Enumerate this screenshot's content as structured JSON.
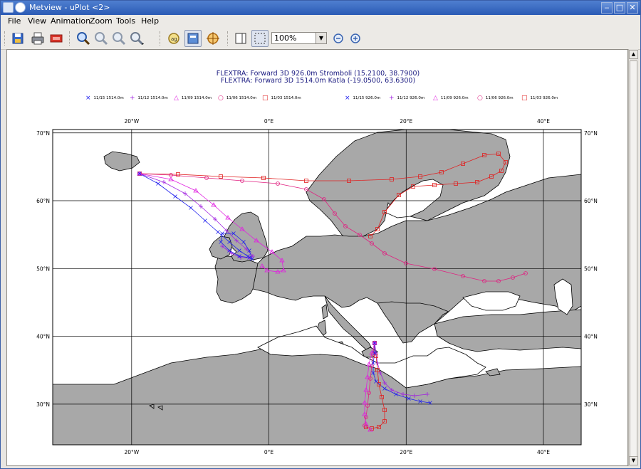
{
  "window": {
    "title": "Metview - uPlot <2>"
  },
  "menu": [
    "File",
    "View",
    "Animation",
    "Zoom",
    "Tools",
    "Help"
  ],
  "toolbar": {
    "zoom_level": "100%",
    "icons": [
      "save-icon",
      "print-icon",
      "export-icon",
      "zoom-icon",
      "zoom-in-icon",
      "zoom-out-icon",
      "zoom-area-icon",
      "magnify-icon",
      "layout-icon",
      "cursor-data-icon",
      "sidebar-icon",
      "frame-icon",
      "zoom-level-select",
      "zoom-out-icon",
      "zoom-in-icon"
    ]
  },
  "plot": {
    "title_lines": [
      "FLEXTRA: Forward 3D 926.0m Stromboli (15.2100, 38.7900)",
      "FLEXTRA: Forward 3D 1514.0m Katla (-19.0500, 63.6300)"
    ],
    "legend": [
      {
        "marker": "×",
        "label": "11/15 1514.0m",
        "color": "#2020ee"
      },
      {
        "marker": "+",
        "label": "11/12 1514.0m",
        "color": "#a020e0"
      },
      {
        "marker": "△",
        "label": "11/09 1514.0m",
        "color": "#e020e0"
      },
      {
        "marker": "○",
        "label": "11/06 1514.0m",
        "color": "#e02080"
      },
      {
        "marker": "□",
        "label": "11/03 1514.0m",
        "color": "#e02020"
      },
      {
        "marker": "×",
        "label": "11/15 926.0m",
        "color": "#2020ee"
      },
      {
        "marker": "+",
        "label": "11/12 926.0m",
        "color": "#a020e0"
      },
      {
        "marker": "△",
        "label": "11/09 926.0m",
        "color": "#e020e0"
      },
      {
        "marker": "○",
        "label": "11/06 926.0m",
        "color": "#e02080"
      },
      {
        "marker": "□",
        "label": "11/03 926.0m",
        "color": "#e02020"
      }
    ],
    "lon_labels": [
      "20°W",
      "0°E",
      "20°E",
      "40°E"
    ],
    "lat_labels": [
      "70°N",
      "60°N",
      "50°N",
      "40°N",
      "30°N"
    ],
    "grid_lons": [
      -20,
      0,
      20,
      40
    ],
    "grid_lats": [
      70,
      60,
      50,
      40,
      30
    ],
    "lon_range": [
      -31.5,
      45.5
    ],
    "lat_range": [
      24,
      70.5
    ],
    "colors": {
      "land": "#a8a8a8",
      "sea": "#ffffff",
      "grid": "#000000"
    }
  }
}
